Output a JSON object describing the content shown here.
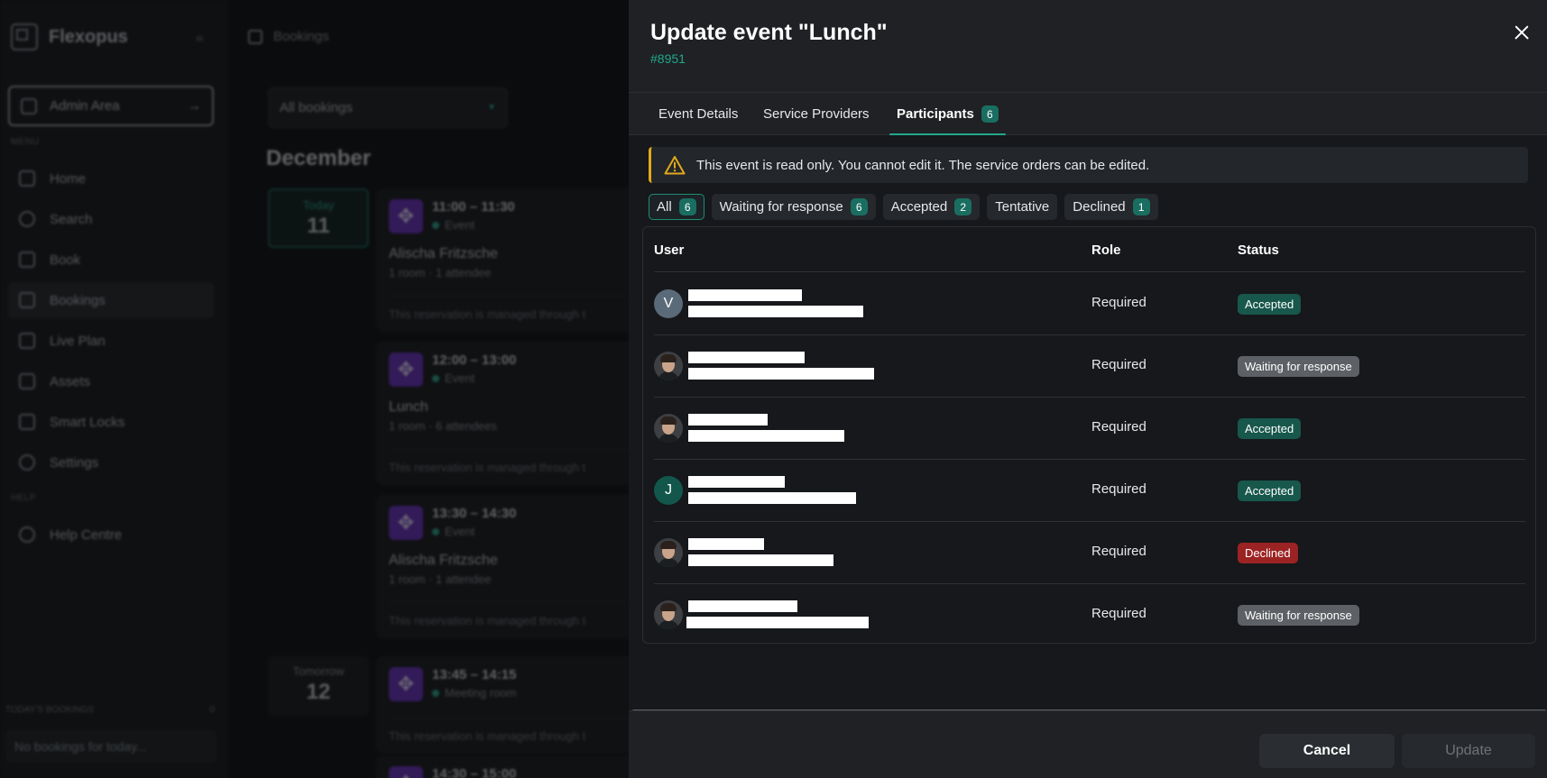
{
  "app": {
    "brand": "Flexopus",
    "admin_area": "Admin Area",
    "menu_label": "MENU",
    "help_label": "HELP",
    "nav": [
      {
        "label": "Home",
        "icon": "home-icon"
      },
      {
        "label": "Search",
        "icon": "search-icon"
      },
      {
        "label": "Book",
        "icon": "book-icon"
      },
      {
        "label": "Bookings",
        "icon": "calendar-icon"
      },
      {
        "label": "Live Plan",
        "icon": "map-icon"
      },
      {
        "label": "Assets",
        "icon": "cube-icon"
      },
      {
        "label": "Smart Locks",
        "icon": "lock-icon"
      },
      {
        "label": "Settings",
        "icon": "gear-icon"
      }
    ],
    "help_centre": "Help Centre",
    "todays_bookings": "TODAY'S BOOKINGS",
    "todays_count": "0",
    "no_bookings": "No bookings for today..."
  },
  "bookings": {
    "breadcrumb": "Bookings",
    "filter": "All bookings",
    "month": "December",
    "days": [
      {
        "label": "Today",
        "num": "11"
      },
      {
        "label": "Tomorrow",
        "num": "12"
      }
    ],
    "cards": [
      {
        "time": "11:00 – 11:30",
        "kind": "Event",
        "who": "Alischa Fritzsche",
        "meta": "1 room · 1 attendee",
        "note": "This reservation is managed through t"
      },
      {
        "time": "12:00 – 13:00",
        "kind": "Event",
        "who": "Lunch",
        "meta": "1 room · 6 attendees",
        "note": "This reservation is managed through t"
      },
      {
        "time": "13:30 – 14:30",
        "kind": "Event",
        "who": "Alischa Fritzsche",
        "meta": "1 room · 1 attendee",
        "note": "This reservation is managed through t"
      },
      {
        "time": "13:45 – 14:15",
        "kind": "Meeting room",
        "who": "",
        "meta": "",
        "note": "This reservation is managed through t"
      },
      {
        "time": "14:30 – 15:00",
        "kind": "",
        "who": "",
        "meta": "",
        "note": ""
      }
    ]
  },
  "modal": {
    "title": "Update event \"Lunch\"",
    "id": "#8951",
    "tabs": [
      {
        "label": "Event Details"
      },
      {
        "label": "Service Providers"
      },
      {
        "label": "Participants",
        "count": "6"
      }
    ],
    "alert": "This event is read only. You cannot edit it. The service orders can be edited.",
    "filters": [
      {
        "label": "All",
        "count": "6"
      },
      {
        "label": "Waiting for response",
        "count": "6"
      },
      {
        "label": "Accepted",
        "count": "2"
      },
      {
        "label": "Tentative"
      },
      {
        "label": "Declined",
        "count": "1"
      }
    ],
    "columns": {
      "user": "User",
      "role": "Role",
      "status": "Status"
    },
    "participants": [
      {
        "avatar": "V",
        "role": "Required",
        "status": "Accepted"
      },
      {
        "avatar": "",
        "role": "Required",
        "status": "Waiting for response"
      },
      {
        "avatar": "",
        "role": "Required",
        "status": "Accepted"
      },
      {
        "avatar": "J",
        "role": "Required",
        "status": "Accepted"
      },
      {
        "avatar": "",
        "role": "Required",
        "status": "Declined"
      },
      {
        "avatar": "",
        "role": "Required",
        "status": "Waiting for response"
      }
    ],
    "cancel": "Cancel",
    "update": "Update"
  },
  "colors": {
    "accent": "#22a88c",
    "warning": "#e2a91d",
    "accepted": "#17574c",
    "waiting": "#5d6065",
    "declined": "#9c2323"
  }
}
